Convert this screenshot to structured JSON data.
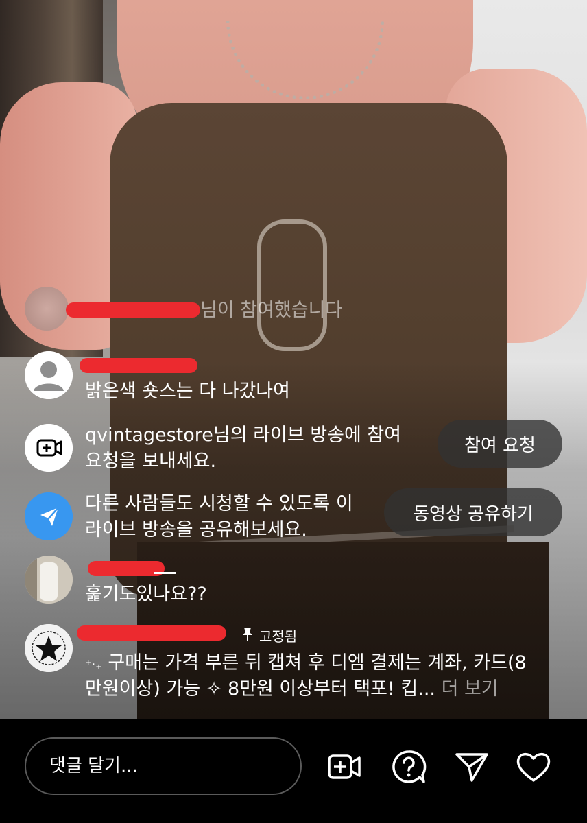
{
  "stream": {
    "description_hidden": true
  },
  "joined_notice": {
    "text": "님이 참여했습니다"
  },
  "comments": [
    {
      "kind": "user",
      "text": "밝은색 숏스는 다 나갔나여"
    },
    {
      "kind": "system",
      "text_line1": "qvintagestore님의 라이브 방송에 참여",
      "text_line2": "요청을 보내세요.",
      "action": "참여 요청"
    },
    {
      "kind": "system",
      "text_line1": "다른 사람들도 시청할 수 있도록 이",
      "text_line2": "라이브 방송을 공유해보세요.",
      "action": "동영상 공유하기"
    },
    {
      "kind": "user",
      "text": "훑기도있나요??"
    },
    {
      "kind": "pinned",
      "pin_label": "고정됨",
      "text_line1": "구매는 가격 부른 뒤 캡쳐 후 디엠 결제는 계좌, 카드(8",
      "text_line2": "만원이상) 가능 ✧ 8만원 이상부터 택포! 킵...",
      "more": "더 보기",
      "bullet": "⁺‧₊"
    }
  ],
  "bottom": {
    "placeholder": "댓글 달기..."
  },
  "colors": {
    "redaction": "#ec2a2f",
    "share_icon_bg": "#3897f0",
    "pill_bg": "#323232"
  }
}
